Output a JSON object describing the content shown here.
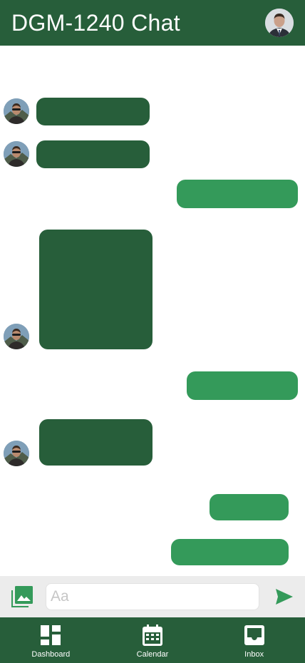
{
  "header": {
    "title": "DGM-1240 Chat"
  },
  "composer": {
    "placeholder": "Aa",
    "value": ""
  },
  "tabs": [
    {
      "label": "Dashboard",
      "icon": "dashboard-icon"
    },
    {
      "label": "Calendar",
      "icon": "calendar-icon"
    },
    {
      "label": "Inbox",
      "icon": "inbox-icon"
    }
  ],
  "colors": {
    "header": "#275e3a",
    "incoming_bubble": "#275e3a",
    "outgoing_bubble": "#349a5a",
    "composer_bar": "#ececec",
    "accent": "#349a5a"
  }
}
